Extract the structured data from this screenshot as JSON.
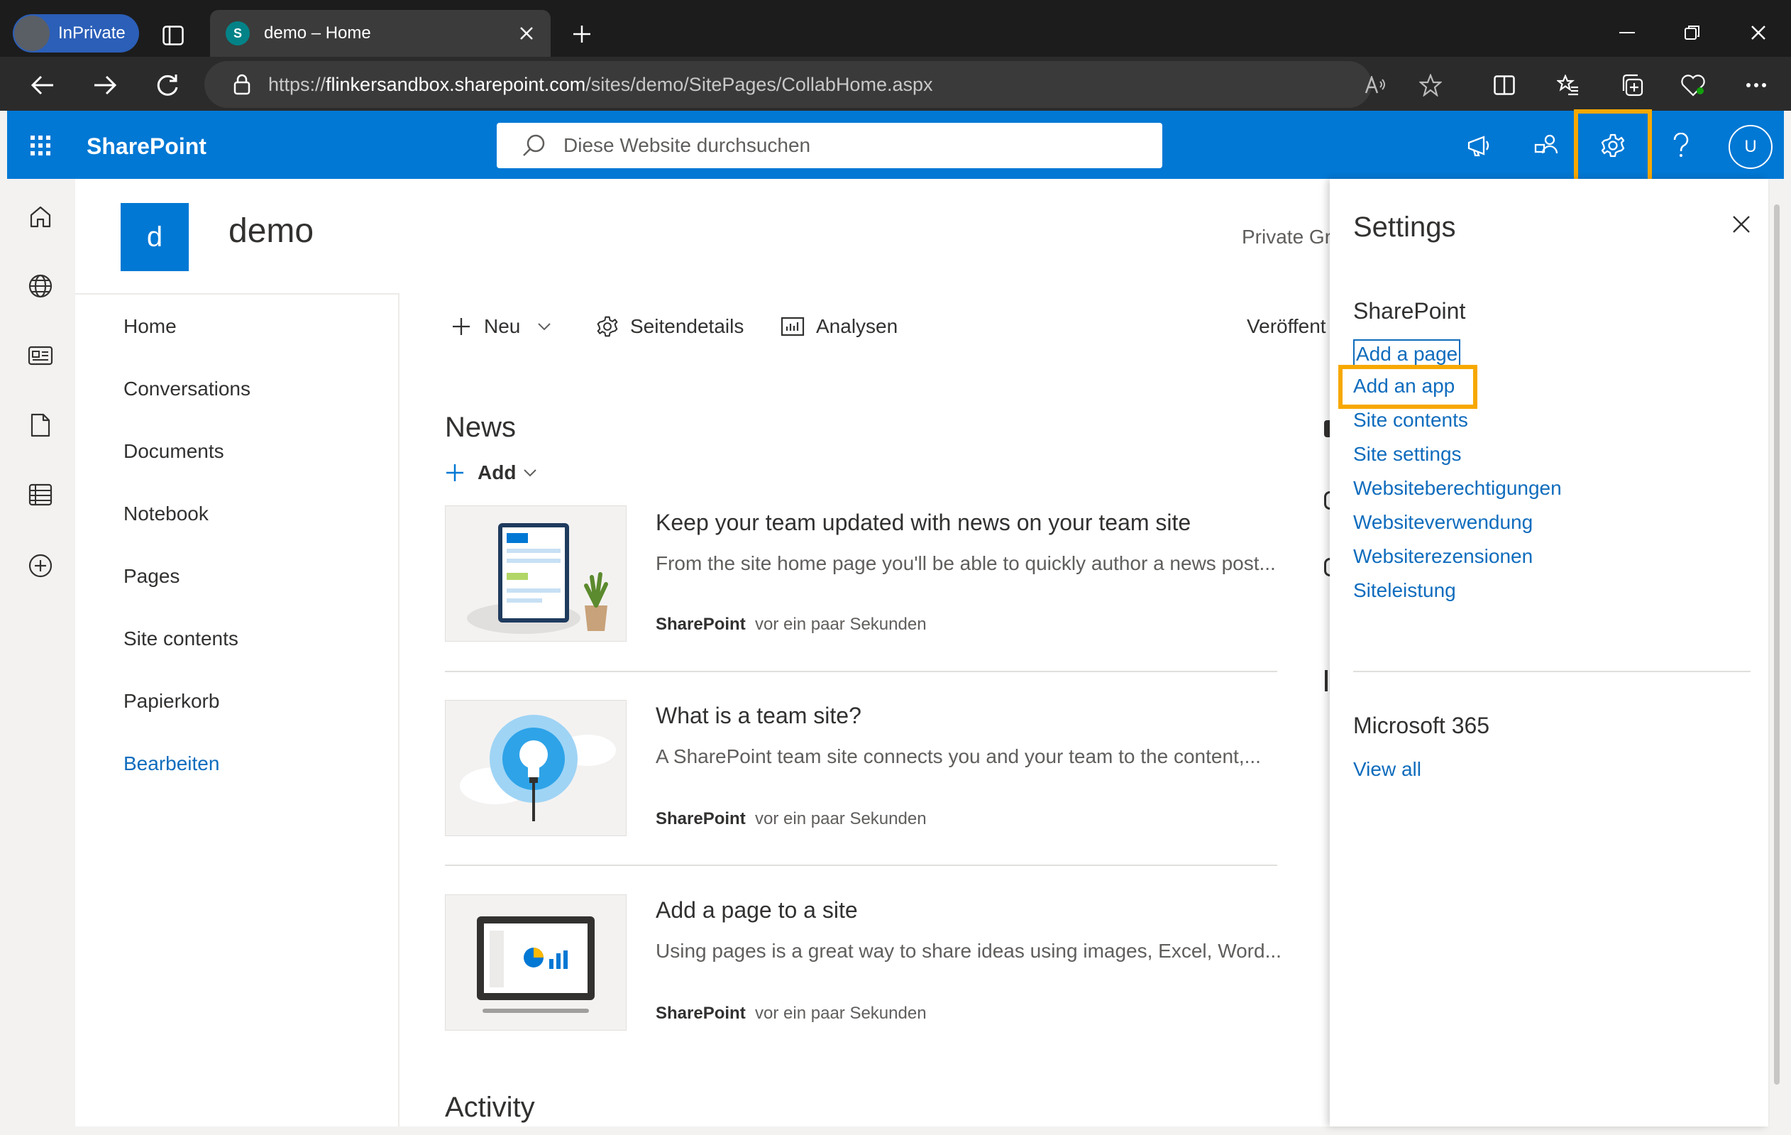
{
  "browser": {
    "inprivate_label": "InPrivate",
    "tab_title": "demo – Home",
    "url_prefix": "https://",
    "url_host": "flinkersandbox.sharepoint.com",
    "url_path": "/sites/demo/SitePages/CollabHome.aspx"
  },
  "suitebar": {
    "brand": "SharePoint",
    "search_placeholder": "Diese Website durchsuchen",
    "avatar_letter": "U"
  },
  "site": {
    "logo_letter": "d",
    "title": "demo",
    "privacy": "Private Gr"
  },
  "leftnav": {
    "items": [
      "Home",
      "Conversations",
      "Documents",
      "Notebook",
      "Pages",
      "Site contents",
      "Papierkorb"
    ],
    "edit": "Bearbeiten"
  },
  "commandbar": {
    "new": "Neu",
    "page_details": "Seitendetails",
    "analytics": "Analysen",
    "publish": "Veröffent"
  },
  "news": {
    "title": "News",
    "add": "Add",
    "cards": [
      {
        "title": "Keep your team updated with news on your team site",
        "desc": "From the site home page you'll be able to quickly author a news post...",
        "author": "SharePoint",
        "time": "vor ein paar Sekunden"
      },
      {
        "title": "What is a team site?",
        "desc": "A SharePoint team site connects you and your team to the content,...",
        "author": "SharePoint",
        "time": "vor ein paar Sekunden"
      },
      {
        "title": "Add a page to a site",
        "desc": "Using pages is a great way to share ideas using images, Excel, Word...",
        "author": "SharePoint",
        "time": "vor ein paar Sekunden"
      }
    ]
  },
  "activity_title": "Activity",
  "settings_panel": {
    "title": "Settings",
    "sharepoint_heading": "SharePoint",
    "links": [
      "Add a page",
      "Add an app",
      "Site contents",
      "Site settings",
      "Websiteberechtigungen",
      "Websiteverwendung",
      "Websiterezensionen",
      "Siteleistung"
    ],
    "m365_heading": "Microsoft 365",
    "view_all": "View all"
  },
  "colors": {
    "suitebar": "#0078d4",
    "link": "#0f6cbd",
    "highlight": "#f7a800"
  },
  "icons": {
    "rail": [
      "home-icon",
      "globe-icon",
      "news-icon",
      "file-icon",
      "list-icon",
      "create-icon"
    ]
  }
}
